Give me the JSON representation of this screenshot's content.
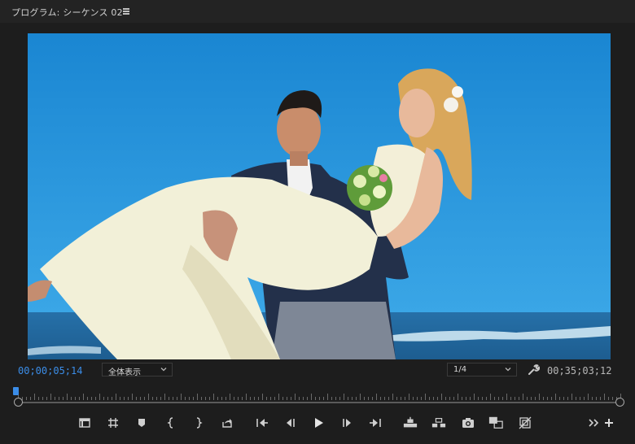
{
  "panel": {
    "title": "プログラム: シーケンス 02",
    "menu_icon": "hamburger-menu-icon"
  },
  "viewer": {
    "content": "wedding-couple-beach-video-frame"
  },
  "status": {
    "current_timecode": "00;00;05;14",
    "duration_timecode": "00;35;03;12",
    "zoom_fit": "全体表示",
    "resolution": "1/4"
  },
  "timeline": {
    "playhead_position": 0.0
  },
  "controls": [
    "add-marker-icon",
    "set-in-out-grid-icon",
    "marker-icon",
    "mark-in-icon",
    "mark-out-icon",
    "export-frame-share-icon",
    "go-to-in-icon",
    "step-back-icon",
    "play-icon",
    "step-forward-icon",
    "go-to-out-icon",
    "lift-icon",
    "extract-icon",
    "export-frame-camera-icon",
    "comparison-view-icon",
    "toggle-proxies-icon",
    "more-icon",
    "add-button-icon"
  ],
  "colors": {
    "accent_timecode": "#3b8de8",
    "sky": "#1f8fd7",
    "panel_bg": "#1d1d1d"
  }
}
